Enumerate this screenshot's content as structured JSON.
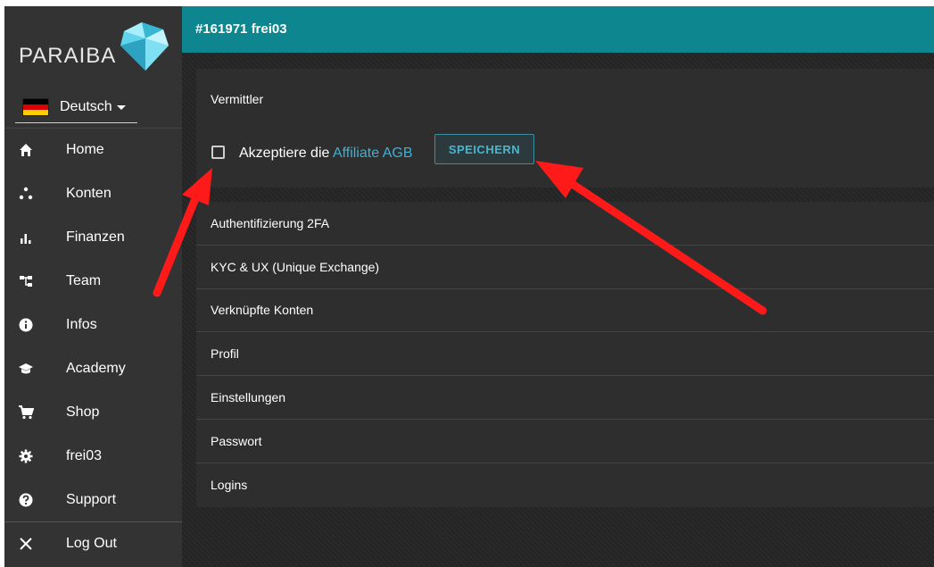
{
  "brand": {
    "logo_text": "PARAIBA"
  },
  "language": {
    "selected": "Deutsch"
  },
  "sidebar": {
    "items": [
      {
        "label": "Home",
        "icon": "home-icon"
      },
      {
        "label": "Konten",
        "icon": "dots-icon"
      },
      {
        "label": "Finanzen",
        "icon": "bar-chart-icon"
      },
      {
        "label": "Team",
        "icon": "org-chart-icon"
      },
      {
        "label": "Infos",
        "icon": "info-icon"
      },
      {
        "label": "Academy",
        "icon": "graduation-cap-icon"
      },
      {
        "label": "Shop",
        "icon": "cart-icon"
      },
      {
        "label": "frei03",
        "icon": "gear-icon"
      },
      {
        "label": "Support",
        "icon": "question-icon"
      }
    ],
    "logout": {
      "label": "Log Out",
      "icon": "close-icon"
    }
  },
  "header": {
    "title": "#161971 frei03"
  },
  "vermittler": {
    "title": "Vermittler",
    "accept_prefix": "Akzeptiere die",
    "accept_link": "Affiliate AGB",
    "save_label": "SPEICHERN"
  },
  "sections": [
    "Authentifizierung 2FA",
    "KYC & UX (Unique Exchange)",
    "Verknüpfte Konten",
    "Profil",
    "Einstellungen",
    "Passwort",
    "Logins"
  ],
  "colors": {
    "accent": "#0e868f",
    "link": "#3bb2d6",
    "sidebar": "#333333",
    "annotation_arrow": "#ff1a1a"
  }
}
